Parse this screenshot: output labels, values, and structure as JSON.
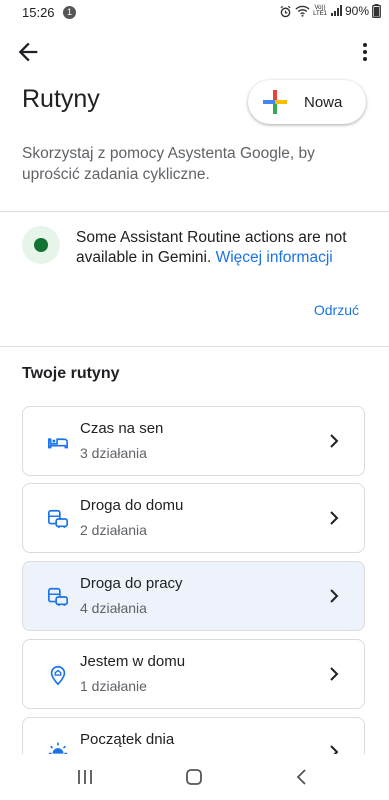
{
  "status": {
    "time": "15:26",
    "notif_count": "1",
    "net_top": "Vo))",
    "net_bottom": "LTE1",
    "battery": "90%"
  },
  "header": {
    "title": "Rutyny",
    "new_button": "Nowa"
  },
  "subtitle": "Skorzystaj z pomocy Asystenta Google, by uprościć zadania cykliczne.",
  "banner": {
    "text": "Some Assistant Routine actions are not available in Gemini.",
    "link": "Więcej informacji",
    "dismiss": "Odrzuć"
  },
  "section_title": "Twoje rutyny",
  "routines": [
    {
      "name": "Czas na sen",
      "count": "3 działania",
      "icon": "bed-icon"
    },
    {
      "name": "Droga do domu",
      "count": "2 działania",
      "icon": "commute-icon"
    },
    {
      "name": "Droga do pracy",
      "count": "4 działania",
      "icon": "commute-icon"
    },
    {
      "name": "Jestem w domu",
      "count": "1 działanie",
      "icon": "home-pin-icon"
    },
    {
      "name": "Początek dnia",
      "count": "",
      "icon": "sunrise-icon"
    }
  ],
  "colors": {
    "accent": "#1a73e8",
    "status_green": "#137333",
    "active_card": "#eef3fb"
  }
}
